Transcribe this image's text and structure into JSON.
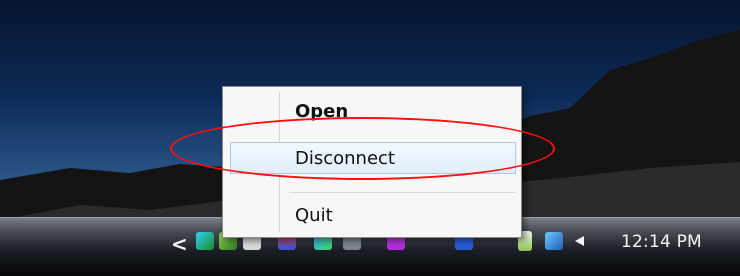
{
  "menu": {
    "items": [
      {
        "label": "Open"
      },
      {
        "label": "Disconnect"
      },
      {
        "label": "Quit"
      }
    ]
  },
  "taskbar": {
    "overflow_arrow": "<",
    "clock": "12:14 PM"
  },
  "icons": {
    "tray": [
      "network-status-icon",
      "app-icon-1",
      "app-icon-2",
      "app-icon-3",
      "app-icon-4",
      "app-icon-5",
      "app-icon-6",
      "app-icon-7",
      "battery-icon",
      "network-icon",
      "speaker-icon"
    ]
  },
  "colors": {
    "highlight": "#ff1010"
  }
}
